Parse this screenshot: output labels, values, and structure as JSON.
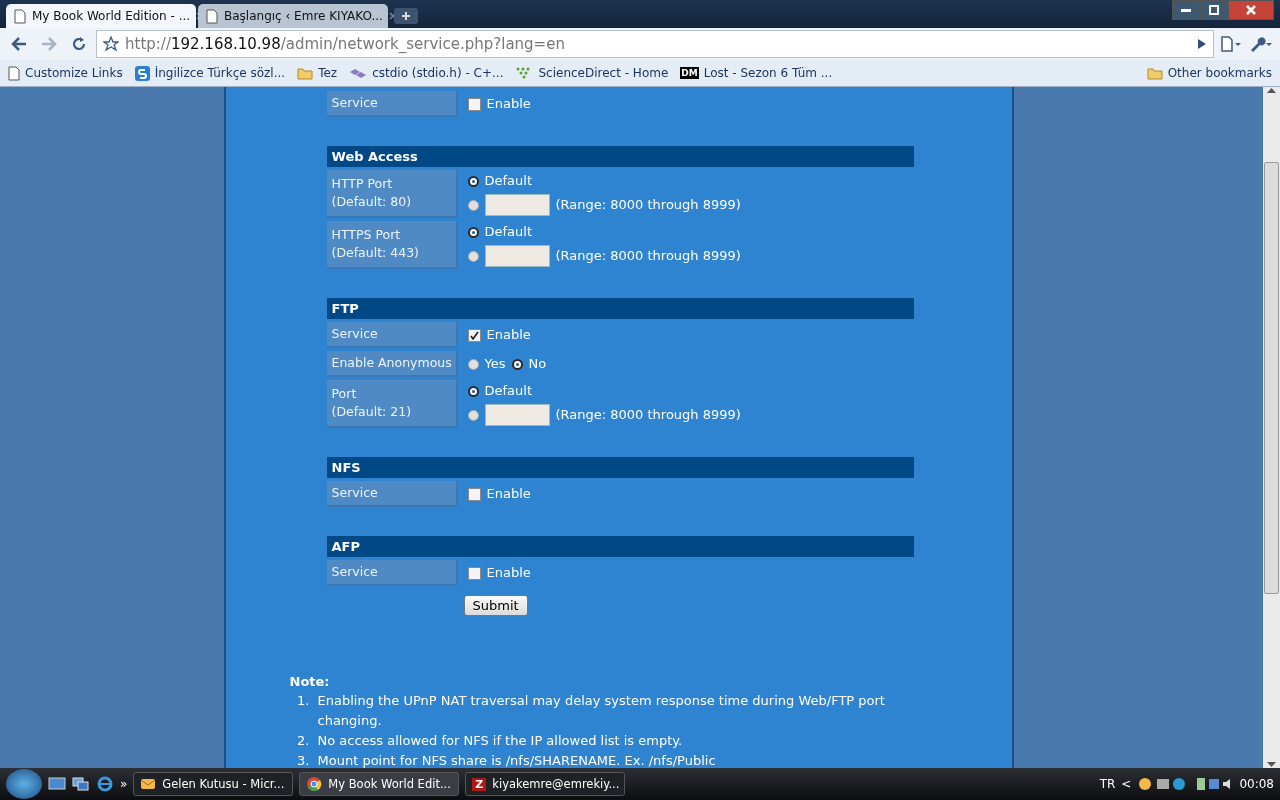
{
  "browser": {
    "tabs": [
      {
        "title": "My Book World Edition - ...",
        "selected": true
      },
      {
        "title": "Başlangıç ‹ Emre KIYAKO...",
        "selected": false
      }
    ],
    "url": {
      "scheme": "http://",
      "host": "192.168.10.98",
      "path": "/admin/network_service.php?lang=en"
    },
    "bookmarks": [
      {
        "label": "Customize Links",
        "kind": "page"
      },
      {
        "label": "İngilizce Türkçe sözl...",
        "kind": "s"
      },
      {
        "label": "Tez",
        "kind": "folder"
      },
      {
        "label": "cstdio (stdio.h) - C+...",
        "kind": "cubes"
      },
      {
        "label": "ScienceDirect - Home",
        "kind": "tree"
      },
      {
        "label": "Lost - Sezon 6 Tüm ...",
        "kind": "dm",
        "badge": "DM"
      }
    ],
    "other_bookmarks": "Other bookmarks"
  },
  "page": {
    "top_row": {
      "label": "Service",
      "option": "Enable",
      "checked": false
    },
    "sections": [
      {
        "title": "Web Access",
        "rows": [
          {
            "kind": "port",
            "label": "HTTP Port",
            "sublabel": "(Default: 80)",
            "default_label": "Default",
            "default_selected": true,
            "custom_selected": false,
            "range": "(Range: 8000 through 8999)"
          },
          {
            "kind": "port",
            "label": "HTTPS Port",
            "sublabel": "(Default: 443)",
            "default_label": "Default",
            "default_selected": true,
            "custom_selected": false,
            "range": "(Range: 8000 through 8999)"
          }
        ]
      },
      {
        "title": "FTP",
        "rows": [
          {
            "kind": "checkbox",
            "label": "Service",
            "option": "Enable",
            "checked": true
          },
          {
            "kind": "radio",
            "label": "Enable Anonymous",
            "options": [
              {
                "label": "Yes",
                "selected": false
              },
              {
                "label": "No",
                "selected": true
              }
            ]
          },
          {
            "kind": "port",
            "label": "Port",
            "sublabel": "(Default: 21)",
            "default_label": "Default",
            "default_selected": true,
            "custom_selected": false,
            "range": "(Range: 8000 through 8999)"
          }
        ]
      },
      {
        "title": "NFS",
        "rows": [
          {
            "kind": "checkbox",
            "label": "Service",
            "option": "Enable",
            "checked": false
          }
        ]
      },
      {
        "title": "AFP",
        "rows": [
          {
            "kind": "checkbox",
            "label": "Service",
            "option": "Enable",
            "checked": false
          }
        ]
      }
    ],
    "submit": "Submit",
    "note": {
      "title": "Note:",
      "items": [
        {
          "number": "1.",
          "text": "Enabling the UPnP NAT traversal may delay system response time during Web/FTP port changing."
        },
        {
          "number": "2.",
          "text": "No access allowed for NFS if the IP allowed list is empty."
        },
        {
          "number": "3.",
          "text": "Mount point for NFS share is /nfs/SHARENAME. Ex. /nfs/Public"
        }
      ]
    }
  },
  "taskbar": {
    "more": "»",
    "tasks": [
      {
        "label": "Gelen Kutusu - Micr...",
        "kind": "mail",
        "selected": false
      },
      {
        "label": "My Book World Edit...",
        "kind": "chrome",
        "selected": true
      },
      {
        "label": "kiyakemre@emrekiy...",
        "kind": "ftp",
        "badge": "Z",
        "selected": false
      }
    ],
    "language": "TR",
    "tray_arrow": "<",
    "time": "00:08"
  }
}
